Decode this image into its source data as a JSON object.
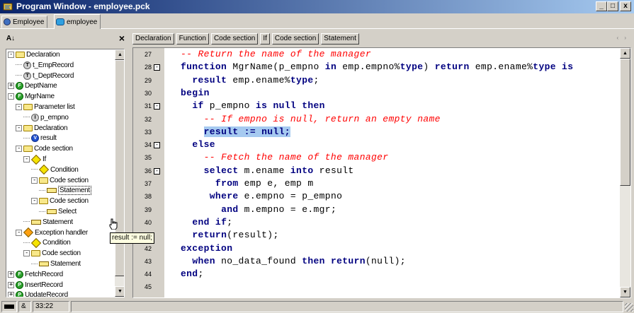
{
  "window": {
    "title": "Program Window - employee.pck",
    "buttons": {
      "minimize": "_",
      "restore": "□",
      "close": "x"
    }
  },
  "tabs": [
    {
      "label": "Employee",
      "icon": "object-icon",
      "active": false
    },
    {
      "label": "employee",
      "icon": "package-icon",
      "active": true
    }
  ],
  "left_panel": {
    "sort_label": "A↓",
    "close_label": "×",
    "tree": [
      {
        "label": "Declaration",
        "level": 0,
        "expander": "-",
        "icon": "folder-icon"
      },
      {
        "label": "t_EmpRecord",
        "level": 1,
        "expander": "",
        "icon": "type-icon",
        "letter": "T"
      },
      {
        "label": "t_DeptRecord",
        "level": 1,
        "expander": "",
        "icon": "type-icon",
        "letter": "T"
      },
      {
        "label": "DeptName",
        "level": 0,
        "expander": "+",
        "icon": "function-icon",
        "letter": "F"
      },
      {
        "label": "MgrName",
        "level": 0,
        "expander": "-",
        "icon": "function-icon",
        "letter": "F"
      },
      {
        "label": "Parameter list",
        "level": 1,
        "expander": "-",
        "icon": "folder-icon"
      },
      {
        "label": "p_empno",
        "level": 2,
        "expander": "",
        "icon": "parameter-icon",
        "letter": "I"
      },
      {
        "label": "Declaration",
        "level": 1,
        "expander": "-",
        "icon": "folder-icon"
      },
      {
        "label": "result",
        "level": 2,
        "expander": "",
        "icon": "variable-icon",
        "letter": "V"
      },
      {
        "label": "Code section",
        "level": 1,
        "expander": "-",
        "icon": "folder-icon"
      },
      {
        "label": "If",
        "level": 2,
        "expander": "-",
        "icon": "if-icon"
      },
      {
        "label": "Condition",
        "level": 3,
        "expander": "",
        "icon": "condition-icon"
      },
      {
        "label": "Code section",
        "level": 3,
        "expander": "-",
        "icon": "folder-icon"
      },
      {
        "label": "Statement",
        "level": 4,
        "expander": "",
        "icon": "statement-icon",
        "selected": true
      },
      {
        "label": "Code section",
        "level": 3,
        "expander": "-",
        "icon": "folder-icon"
      },
      {
        "label": "Select",
        "level": 4,
        "expander": "",
        "icon": "statement-icon"
      },
      {
        "label": "Statement",
        "level": 2,
        "expander": "",
        "icon": "statement-icon"
      },
      {
        "label": "Exception handler",
        "level": 1,
        "expander": "-",
        "icon": "exception-icon"
      },
      {
        "label": "Condition",
        "level": 2,
        "expander": "",
        "icon": "condition-icon"
      },
      {
        "label": "Code section",
        "level": 2,
        "expander": "-",
        "icon": "folder-icon"
      },
      {
        "label": "Statement",
        "level": 3,
        "expander": "",
        "icon": "statement-icon"
      },
      {
        "label": "FetchRecord",
        "level": 0,
        "expander": "+",
        "icon": "function-icon",
        "letter": "F"
      },
      {
        "label": "InsertRecord",
        "level": 0,
        "expander": "+",
        "icon": "procedure-icon",
        "letter": "P"
      },
      {
        "label": "UpdateRecord",
        "level": 0,
        "expander": "+",
        "icon": "procedure-icon",
        "letter": "P"
      },
      {
        "label": "deleterecord",
        "level": 0,
        "expander": "+",
        "icon": "procedure-icon",
        "letter": "P"
      }
    ],
    "tooltip": "result := null;"
  },
  "breadcrumbs": [
    "Declaration",
    "Function",
    "Code section",
    "If",
    "Code section",
    "Statement"
  ],
  "nav_arrows": "‹ ›",
  "editor": {
    "lines": [
      {
        "num": "27",
        "fold": "",
        "segments": [
          [
            "c",
            "-- Return the name of the manager"
          ]
        ]
      },
      {
        "num": "28",
        "fold": "-",
        "segments": [
          [
            "k",
            "function"
          ],
          [
            "t",
            " MgrName(p_empno "
          ],
          [
            "k",
            "in"
          ],
          [
            "t",
            " emp.empno%"
          ],
          [
            "k",
            "type"
          ],
          [
            "t",
            ") "
          ],
          [
            "k",
            "return"
          ],
          [
            "t",
            " emp.ename%"
          ],
          [
            "k",
            "type is"
          ]
        ]
      },
      {
        "num": "29",
        "fold": "",
        "segments": [
          [
            "t",
            "  "
          ],
          [
            "k",
            "result"
          ],
          [
            "t",
            " emp.ename%"
          ],
          [
            "k",
            "type"
          ],
          [
            "t",
            ";"
          ]
        ]
      },
      {
        "num": "30",
        "fold": "",
        "segments": [
          [
            "k",
            "begin"
          ]
        ]
      },
      {
        "num": "31",
        "fold": "-",
        "segments": [
          [
            "t",
            "  "
          ],
          [
            "k",
            "if"
          ],
          [
            "t",
            " p_empno "
          ],
          [
            "k",
            "is null then"
          ]
        ]
      },
      {
        "num": "32",
        "fold": "",
        "segments": [
          [
            "t",
            "    "
          ],
          [
            "c",
            "-- If empno is null, return an empty name"
          ]
        ]
      },
      {
        "num": "33",
        "fold": "",
        "segments": [
          [
            "t",
            "    "
          ],
          [
            "h",
            "result := null;"
          ]
        ]
      },
      {
        "num": "34",
        "fold": "-",
        "segments": [
          [
            "t",
            "  "
          ],
          [
            "k",
            "else"
          ]
        ]
      },
      {
        "num": "35",
        "fold": "",
        "segments": [
          [
            "t",
            "    "
          ],
          [
            "c",
            "-- Fetch the name of the manager"
          ]
        ]
      },
      {
        "num": "36",
        "fold": "-",
        "segments": [
          [
            "t",
            "    "
          ],
          [
            "k",
            "select"
          ],
          [
            "t",
            " m.ename "
          ],
          [
            "k",
            "into"
          ],
          [
            "t",
            " result"
          ]
        ]
      },
      {
        "num": "37",
        "fold": "",
        "segments": [
          [
            "t",
            "      "
          ],
          [
            "k",
            "from"
          ],
          [
            "t",
            " emp e, emp m"
          ]
        ]
      },
      {
        "num": "38",
        "fold": "",
        "segments": [
          [
            "t",
            "     "
          ],
          [
            "k",
            "where"
          ],
          [
            "t",
            " e.empno = p_empno"
          ]
        ]
      },
      {
        "num": "39",
        "fold": "",
        "segments": [
          [
            "t",
            "       "
          ],
          [
            "k",
            "and"
          ],
          [
            "t",
            " m.empno = e.mgr;"
          ]
        ]
      },
      {
        "num": "40",
        "fold": "",
        "segments": [
          [
            "t",
            "  "
          ],
          [
            "k",
            "end if"
          ],
          [
            "t",
            ";"
          ]
        ]
      },
      {
        "num": "41",
        "fold": "",
        "segments": [
          [
            "t",
            "  "
          ],
          [
            "k",
            "return"
          ],
          [
            "t",
            "(result);"
          ]
        ]
      },
      {
        "num": "42",
        "fold": "",
        "segments": [
          [
            "k",
            "exception"
          ]
        ]
      },
      {
        "num": "43",
        "fold": "",
        "segments": [
          [
            "t",
            "  "
          ],
          [
            "k",
            "when"
          ],
          [
            "t",
            " no_data_found "
          ],
          [
            "k",
            "then return"
          ],
          [
            "t",
            "(null);"
          ]
        ]
      },
      {
        "num": "44",
        "fold": "",
        "segments": [
          [
            "k",
            "end"
          ],
          [
            "t",
            ";"
          ]
        ]
      },
      {
        "num": "45",
        "fold": "",
        "segments": []
      }
    ]
  },
  "statusbar": {
    "modified": "&",
    "position": "33:22"
  }
}
